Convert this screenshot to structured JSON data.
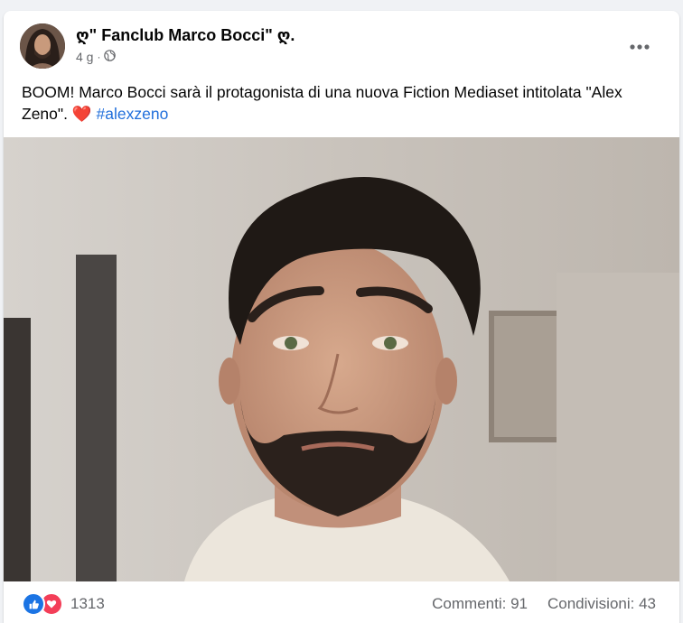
{
  "post": {
    "page_name": "ღ\" Fanclub Marco Bocci\" ღ.",
    "time": "4 g",
    "separator": "·",
    "privacy_icon": "globe-icon",
    "more_icon": "more-options-icon",
    "caption_text": "BOOM! Marco Bocci sarà il protagonista di una nuova Fiction Mediaset intitolata \"Alex Zeno\".",
    "caption_emoji": "❤️",
    "hashtag": "#alexzeno",
    "image_icon": "post-photo"
  },
  "footer": {
    "reaction_icons": [
      "like-icon",
      "love-icon"
    ],
    "reaction_count": "1313",
    "comments": "Commenti: 91",
    "shares": "Condivisioni: 43"
  },
  "colors": {
    "accent": "#1b74e4",
    "love": "#f33e58",
    "hashtag": "#216fdb",
    "muted": "#65676b"
  }
}
